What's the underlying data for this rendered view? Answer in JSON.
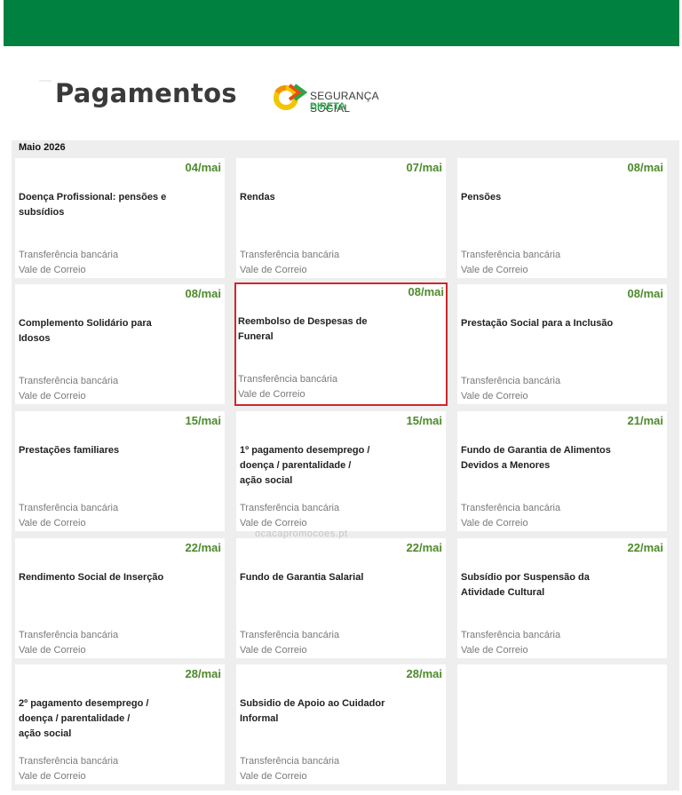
{
  "header": {
    "title": "Pagamentos",
    "logo_line1": "SEGURANÇA SOCIAL",
    "logo_line2": "DIRETA"
  },
  "month": "Maio 2026",
  "watermark": "ocacapromocoes.pt",
  "colors": {
    "topbar": "#008140",
    "date": "#4d8a2b",
    "highlight_border": "#d0262c",
    "logo_green": "#2aa64a",
    "logo_orange": "#f39200"
  },
  "payments": [
    {
      "date": "04/mai",
      "title": "Doença Profissional: pensões e\nsubsídios",
      "methods": [
        "Transferência bancária",
        "Vale de Correio"
      ]
    },
    {
      "date": "07/mai",
      "title": "Rendas",
      "methods": [
        "Transferência bancária",
        "Vale de Correio"
      ]
    },
    {
      "date": "08/mai",
      "title": "Pensões",
      "methods": [
        "Transferência bancária",
        "Vale de Correio"
      ]
    },
    {
      "date": "08/mai",
      "title": "Complemento Solidário para\nIdosos",
      "methods": [
        "Transferência bancária",
        "Vale de Correio"
      ]
    },
    {
      "date": "08/mai",
      "title": "Reembolso de Despesas de\nFuneral",
      "methods": [
        "Transferência bancária",
        "Vale de Correio"
      ],
      "highlighted": true
    },
    {
      "date": "08/mai",
      "title": "Prestação Social para a Inclusão",
      "methods": [
        "Transferência bancária",
        "Vale de Correio"
      ]
    },
    {
      "date": "15/mai",
      "title": "Prestações familiares",
      "methods": [
        "Transferência bancária",
        "Vale de Correio"
      ]
    },
    {
      "date": "15/mai",
      "title": "1º pagamento desemprego /\ndoença / parentalidade /\nação social",
      "methods": [
        "Transferência bancária",
        "Vale de Correio"
      ]
    },
    {
      "date": "21/mai",
      "title": "Fundo de Garantia de Alimentos\n Devidos a Menores",
      "methods": [
        "Transferência bancária",
        "Vale de Correio"
      ]
    },
    {
      "date": "22/mai",
      "title": "Rendimento Social de Inserção",
      "methods": [
        "Transferência bancária",
        "Vale de Correio"
      ]
    },
    {
      "date": "22/mai",
      "title": "Fundo de Garantia Salarial",
      "methods": [
        "Transferência bancária",
        "Vale de Correio"
      ]
    },
    {
      "date": "22/mai",
      "title": "Subsídio por Suspensão da\nAtividade Cultural",
      "methods": [
        "Transferência bancária",
        "Vale de Correio"
      ]
    },
    {
      "date": "28/mai",
      "title": "2º pagamento desemprego /\ndoença / parentalidade /\nação social",
      "methods": [
        "Transferência bancária",
        "Vale de Correio"
      ]
    },
    {
      "date": "28/mai",
      "title": "Subsidio de Apoio ao Cuidador\n Informal",
      "methods": [
        "Transferência bancária",
        "Vale de Correio"
      ]
    }
  ]
}
